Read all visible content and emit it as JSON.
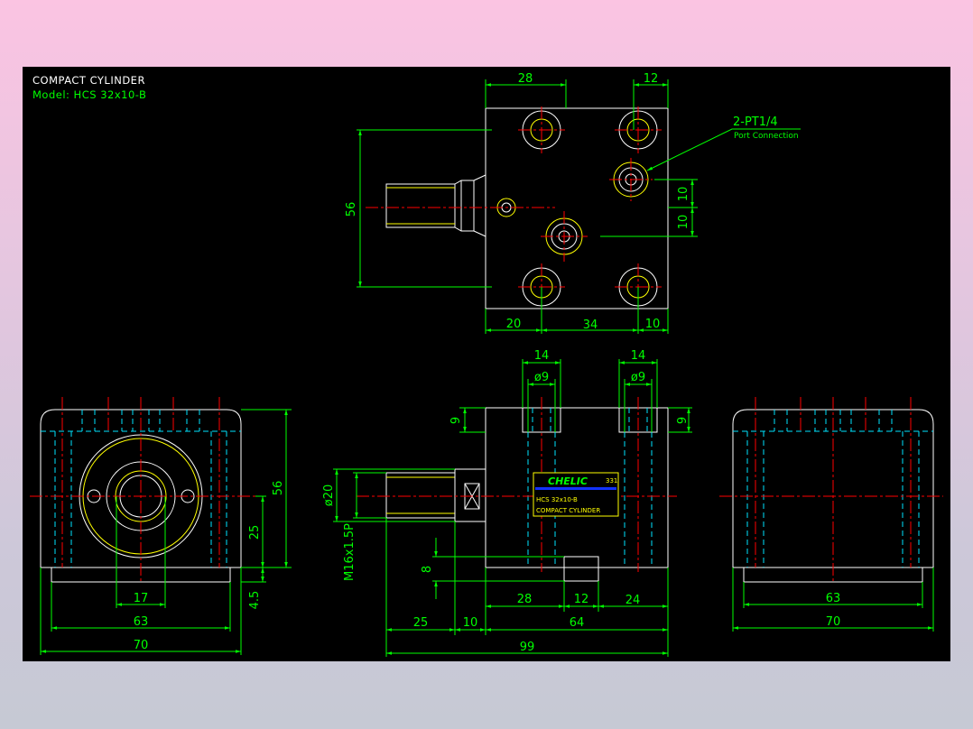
{
  "title": {
    "line1": "COMPACT CYLINDER",
    "line2": "Model: HCS 32x10-B"
  },
  "colors": {
    "sheet_background": "#000000",
    "outline": "#ffffff",
    "dimension": "#00ff00",
    "center_line": "#ff0000",
    "hidden_line": "#00e5ff",
    "thread": "#ffff00",
    "label_plate": "#ffff00",
    "brand_text": "#00ff00",
    "plate_stripe": "#1133ff"
  },
  "top_view": {
    "dims": {
      "width_28": "28",
      "width_12": "12",
      "height_56": "56",
      "port_10_a": "10",
      "port_10_b": "10",
      "bottom_20": "20",
      "bottom_34": "34",
      "bottom_10": "10"
    },
    "callout": {
      "label": "2-PT1/4",
      "sublabel": "Port Connection"
    }
  },
  "front_view": {
    "dims": {
      "slot_14_left": "14",
      "slot_14_right": "14",
      "dia_9_left": "ø9",
      "dia_9_right": "ø9",
      "depth_9_left": "9",
      "depth_9_right": "9",
      "rod_dia": "ø20",
      "thread": "M16x1.5P",
      "key_8": "8",
      "seg_28": "28",
      "seg_12": "12",
      "seg_24": "24",
      "seg_25": "25",
      "seg_10": "10",
      "seg_64": "64",
      "total_99": "99"
    },
    "plate": {
      "brand": "CHELIC",
      "code": "331",
      "model": "HCS 32x10-B",
      "name": "COMPACT CYLINDER"
    }
  },
  "left_view": {
    "dims": {
      "height_56": "56",
      "height_25": "25",
      "height_4_5": "4.5",
      "width_17": "17",
      "width_63": "63",
      "width_70": "70"
    }
  },
  "right_view": {
    "dims": {
      "width_63": "63",
      "width_70": "70"
    }
  }
}
